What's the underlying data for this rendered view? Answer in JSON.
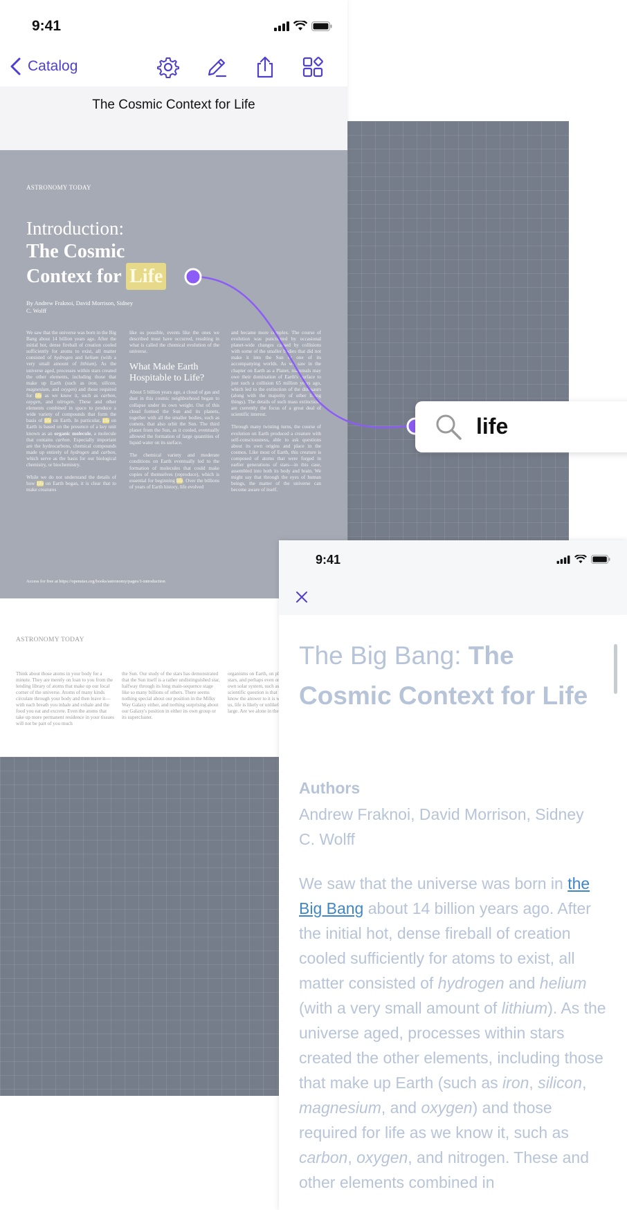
{
  "reader": {
    "status_time": "9:41",
    "back_label": "Catalog",
    "doc_title": "The Cosmic Context for Life",
    "page1": {
      "source": "ASTRONOMY TODAY",
      "intro": "Introduction:",
      "title_line1": "The Cosmic",
      "title_line2": "Context for",
      "title_highlight": "Life",
      "authors": "By Andrew Fraknoi, David Morrison, Sidney C. Wolff",
      "subheading": "What Made Earth Hospitable to Life?",
      "footer": "Access for free at https://openstax.org/books/astronomy/pages/1-introduction",
      "col_a": {
        "t1": "We saw that the universe was born in the Big Bang about 14 billion years ago. After the initial hot, dense fireball of creation cooled sufficiently for atoms to exist, all matter consisted of ",
        "hydrogen": "hydrogen",
        "t2": " and ",
        "helium": "helium",
        "t3": " (with a very small amount of ",
        "lithium": "lithium",
        "t4": "). As the universe aged, processes within stars created the other elements, including those that make up Earth (such as ",
        "iron": "iron",
        "t5": ", ",
        "silicon": "silicon",
        "t6": ", ",
        "magnesium": "magnesium",
        "t7": ", and ",
        "oxygen": "oxygen",
        "t8": ") and those required for ",
        "hl1": "life",
        "t9": " as we know it, such as ",
        "carbon": "carbon",
        "t10": ", ",
        "oxygen2": "oxygen",
        "t11": ", and ",
        "nitrogen": "nitrogen",
        "t12": ". These and other elements combined in space to produce a wide variety of compounds that form the basis of ",
        "hl2": "life",
        "t13": " on Earth. In particular, ",
        "hl3": "life",
        "t14": " on Earth is based on the presence of a key unit known as an ",
        "organic": "organic molecule",
        "t15": ", a molecule that contains ",
        "carbon2": "carbon",
        "t16": ". Especially important are the hydrocarbons, chemical compounds made up entirely of ",
        "hydrogen2": "hydrogen",
        "t17": " and ",
        "carbon3": "carbon",
        "t18": ", which serve as the basis for our biological chemistry, or biochemistry.",
        "t19": "While we do not understand the details of how ",
        "hl4": "life",
        "t20": " on Earth began, it is clear that to make creatures"
      },
      "col_b": {
        "t1": "like us possible, events like the ones we described must have occurred, resulting in what is called the chemical evolution of the universe.",
        "t2": "About 5 billion years ago, a cloud of gas and dust in this cosmic neighborhood began to collapse under its own weight. Out of this cloud formed the Sun and its planets, together with all the smaller bodies, such as comets, that also orbit the Sun. The third planet from the Sun, as it cooled, eventually allowed the formation of large quantities of liquid water on its surface.",
        "t3": "The chemical variety and moderate conditions on Earth eventually led to the formation of molecules that could make copies of themselves (reproduce), which is essential for beginning ",
        "hl": "life",
        "t4": ". Over the billions of years of Earth history, life evolved"
      },
      "col_c": {
        "t1": "and became more complex. The course of evolution was punctuated by occasional planet-wide changes caused by collisions with some of the smaller bodies that did not make it into the Sun or one of its accompanying worlds. As we saw in the chapter on Earth as a Planet, mammals may owe their domination of Earth's surface to just such a collision 65 million years ago, which led to the extinction of the dinosaurs (along with the majority of other living things). The details of such mass extinctions are currently the focus of a great deal of scientific interest.",
        "t2": "Through many twisting turns, the course of evolution on Earth produced a creature with self-consciousness, able to ask questions about its own origins and place in the cosmos. Like most of Earth, this creature is composed of atoms that were forged in earlier generations of stars—in this case, assembled into both its body and brain. We might say that through the eyes of human beings, the matter of the universe can become aware of itself."
      }
    },
    "page2": {
      "source": "ASTRONOMY TODAY",
      "col_a": "Think about those atoms in your body for a minute. They are merely on loan to you from the lending library of atoms that make up our local corner of the universe. Atoms of many kinds circulate through your body and then leave it—with each breath you inhale and exhale and the food you eat and excrete. Even the atoms that take up more permanent residence in your tissues will not be part of you much",
      "col_b": "the Sun. Our study of the stars has demonstrated that the Sun itself is a rather undistinguished star, halfway through its long main-sequence stage like so many billions of others. There seems nothing special about our position in the Milky Way Galaxy either, and nothing surprising about our Galaxy's position in either its own group or its supercluster.",
      "col_c": "organisms on Earth, on planets around other stars, and perhaps even on other planets in our own solar system, such as Mars. The real scientific question is that we do not currently know the answer to it is whether organisms like us, life is likely or unlikely in the universe at large. Are we alone in the universe? If life"
    }
  },
  "search": {
    "term": "life"
  },
  "info": {
    "status_time": "9:41",
    "title_light": "The Big Bang: ",
    "title_bold": "The Cosmic Context for Life",
    "authors_label": "Authors",
    "authors_value": "Andrew Fraknoi, David Morrison, Sidney C. Wolff",
    "body": {
      "t1": "We saw that the universe was born in ",
      "link": "the Big Bang",
      "t2": " about 14 billion years ago. After the initial hot, dense fireball of creation cooled sufficiently for atoms to exist, all matter consisted of ",
      "hydrogen": "hydrogen",
      "t3": " and ",
      "helium": "helium",
      "t4": " (with a very small amount of ",
      "lithium": "lithium",
      "t5": "). As the universe aged, processes within stars created the other elements, including those that make up Earth (such as ",
      "iron": "iron",
      "t6": ", ",
      "silicon": "silicon",
      "t7": ", ",
      "magnesium": "magnesium",
      "t8": ", and ",
      "oxygen": "oxygen",
      "t9": ") and those required for life as we know it, such as ",
      "carbon": "carbon",
      "t10": ", ",
      "oxygen2": "oxygen",
      "t11": ", and nitrogen. These and other elements combined in"
    }
  },
  "colors": {
    "accent": "#8b5cf6",
    "link": "#4e3fcf",
    "highlight": "#e6d98a",
    "canvas": "#767d8a"
  },
  "icons": [
    "chevron-left-icon",
    "gear-icon",
    "pencil-icon",
    "share-icon",
    "grid-icon",
    "search-icon",
    "close-icon",
    "signal-icon",
    "wifi-icon",
    "battery-icon"
  ]
}
